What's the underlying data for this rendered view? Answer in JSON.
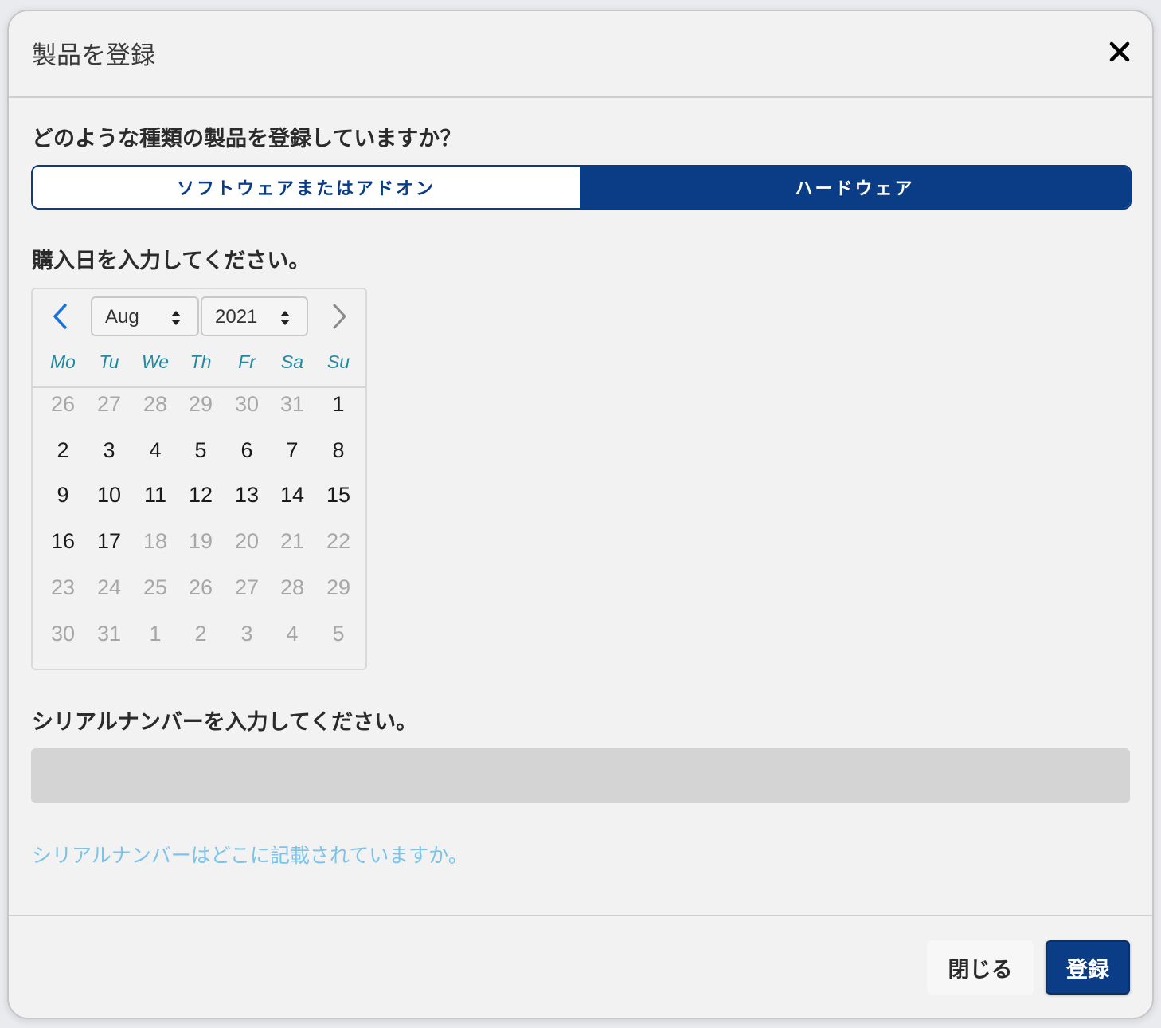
{
  "dialog": {
    "title": "製品を登録",
    "close_icon": "close-icon"
  },
  "product_type": {
    "question": "どのような種類の製品を登録していますか？",
    "options": [
      {
        "label": "ソフトウェアまたはアドオン",
        "selected": false
      },
      {
        "label": "ハードウェア",
        "selected": true
      }
    ],
    "accent_color": "#0b3d86"
  },
  "purchase_date": {
    "label": "購入日を入力してください。",
    "calendar": {
      "month": "Aug",
      "year": "2021",
      "prev_icon": "chevron-left-icon",
      "next_icon": "chevron-right-icon",
      "weekdays": [
        "Mo",
        "Tu",
        "We",
        "Th",
        "Fr",
        "Sa",
        "Su"
      ],
      "weeks": [
        [
          {
            "d": "26",
            "s": "dim"
          },
          {
            "d": "27",
            "s": "dim"
          },
          {
            "d": "28",
            "s": "dim"
          },
          {
            "d": "29",
            "s": "dim"
          },
          {
            "d": "30",
            "s": "dim"
          },
          {
            "d": "31",
            "s": "dim"
          },
          {
            "d": "1",
            "s": "cur"
          }
        ],
        [
          {
            "d": "2",
            "s": "cur"
          },
          {
            "d": "3",
            "s": "cur"
          },
          {
            "d": "4",
            "s": "cur"
          },
          {
            "d": "5",
            "s": "cur"
          },
          {
            "d": "6",
            "s": "cur"
          },
          {
            "d": "7",
            "s": "cur"
          },
          {
            "d": "8",
            "s": "cur"
          }
        ],
        [
          {
            "d": "9",
            "s": "cur"
          },
          {
            "d": "10",
            "s": "cur"
          },
          {
            "d": "11",
            "s": "cur"
          },
          {
            "d": "12",
            "s": "cur"
          },
          {
            "d": "13",
            "s": "cur"
          },
          {
            "d": "14",
            "s": "cur"
          },
          {
            "d": "15",
            "s": "cur"
          }
        ],
        [
          {
            "d": "16",
            "s": "cur"
          },
          {
            "d": "17",
            "s": "cur"
          },
          {
            "d": "18",
            "s": "dim"
          },
          {
            "d": "19",
            "s": "dim"
          },
          {
            "d": "20",
            "s": "dim"
          },
          {
            "d": "21",
            "s": "dim"
          },
          {
            "d": "22",
            "s": "dim"
          }
        ],
        [
          {
            "d": "23",
            "s": "dim"
          },
          {
            "d": "24",
            "s": "dim"
          },
          {
            "d": "25",
            "s": "dim"
          },
          {
            "d": "26",
            "s": "dim"
          },
          {
            "d": "27",
            "s": "dim"
          },
          {
            "d": "28",
            "s": "dim"
          },
          {
            "d": "29",
            "s": "dim"
          }
        ],
        [
          {
            "d": "30",
            "s": "dim"
          },
          {
            "d": "31",
            "s": "dim"
          },
          {
            "d": "1",
            "s": "dim"
          },
          {
            "d": "2",
            "s": "dim"
          },
          {
            "d": "3",
            "s": "dim"
          },
          {
            "d": "4",
            "s": "dim"
          },
          {
            "d": "5",
            "s": "dim"
          }
        ]
      ]
    }
  },
  "serial": {
    "label": "シリアルナンバーを入力してください。",
    "value": "",
    "help_link": "シリアルナンバーはどこに記載されていますか。"
  },
  "footer": {
    "close_label": "閉じる",
    "register_label": "登録"
  }
}
